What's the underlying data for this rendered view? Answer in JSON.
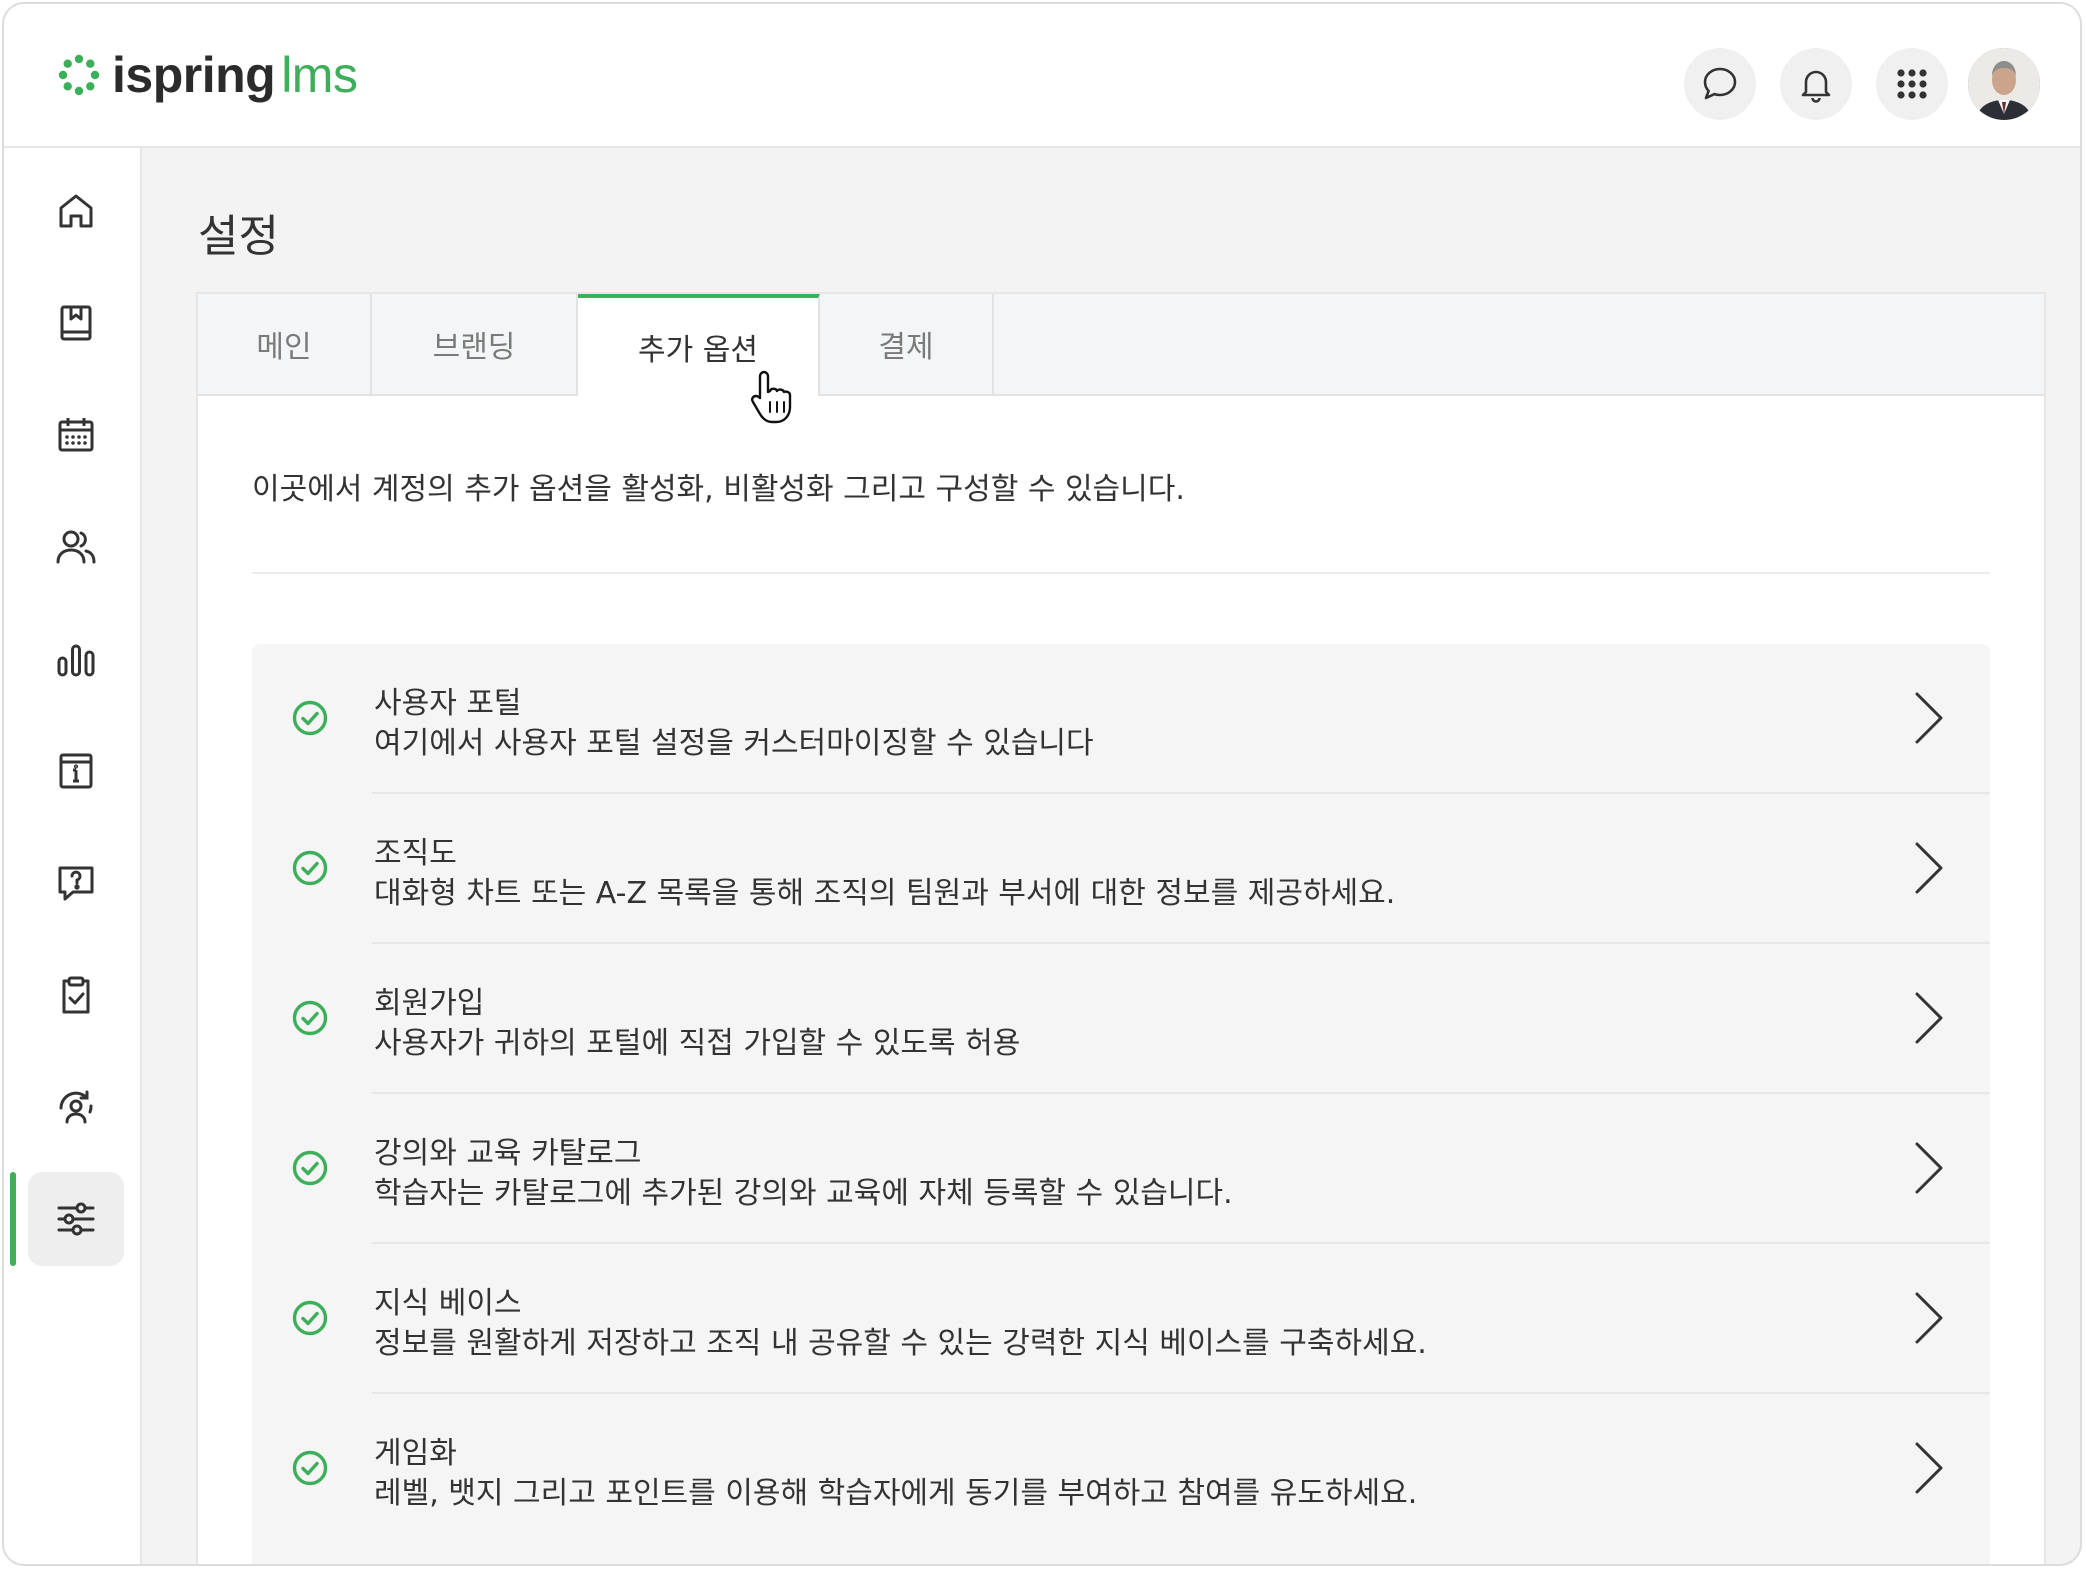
{
  "brand": {
    "word1": "ispring",
    "word2": "lms",
    "accent_color": "#3dae5a"
  },
  "header": {
    "buttons": [
      {
        "name": "chat-icon"
      },
      {
        "name": "bell-icon"
      },
      {
        "name": "apps-grid-icon"
      },
      {
        "name": "user-avatar"
      }
    ]
  },
  "sidebar": {
    "items": [
      {
        "icon": "home-icon"
      },
      {
        "icon": "book-icon"
      },
      {
        "icon": "calendar-icon"
      },
      {
        "icon": "users-icon"
      },
      {
        "icon": "reports-icon"
      },
      {
        "icon": "info-icon"
      },
      {
        "icon": "question-icon"
      },
      {
        "icon": "clipboard-check-icon"
      },
      {
        "icon": "user-cycle-icon"
      },
      {
        "icon": "settings-sliders-icon",
        "active": true
      }
    ]
  },
  "page": {
    "title": "설정"
  },
  "tabs": [
    {
      "label": "메인"
    },
    {
      "label": "브랜딩"
    },
    {
      "label": "추가 옵션",
      "active": true
    },
    {
      "label": "결제"
    }
  ],
  "content": {
    "description": "이곳에서 계정의 추가 옵션을 활성화, 비활성화 그리고 구성할 수 있습니다."
  },
  "options": [
    {
      "title": "사용자 포털",
      "subtitle": "여기에서 사용자 포털 설정을 커스터마이징할 수 있습니다",
      "enabled": true
    },
    {
      "title": "조직도",
      "subtitle": "대화형 차트 또는 A-Z 목록을 통해 조직의 팀원과 부서에 대한 정보를 제공하세요.",
      "enabled": true
    },
    {
      "title": "회원가입",
      "subtitle": "사용자가 귀하의 포털에 직접 가입할 수 있도록 허용",
      "enabled": true
    },
    {
      "title": "강의와 교육 카탈로그",
      "subtitle": "학습자는 카탈로그에 추가된 강의와 교육에 자체 등록할 수 있습니다.",
      "enabled": true
    },
    {
      "title": "지식 베이스",
      "subtitle": "정보를 원활하게 저장하고 조직 내 공유할 수 있는 강력한 지식 베이스를 구축하세요.",
      "enabled": true
    },
    {
      "title": "게임화",
      "subtitle": "레벨, 뱃지 그리고 포인트를 이용해 학습자에게 동기를 부여하고 참여를 유도하세요.",
      "enabled": true
    }
  ]
}
